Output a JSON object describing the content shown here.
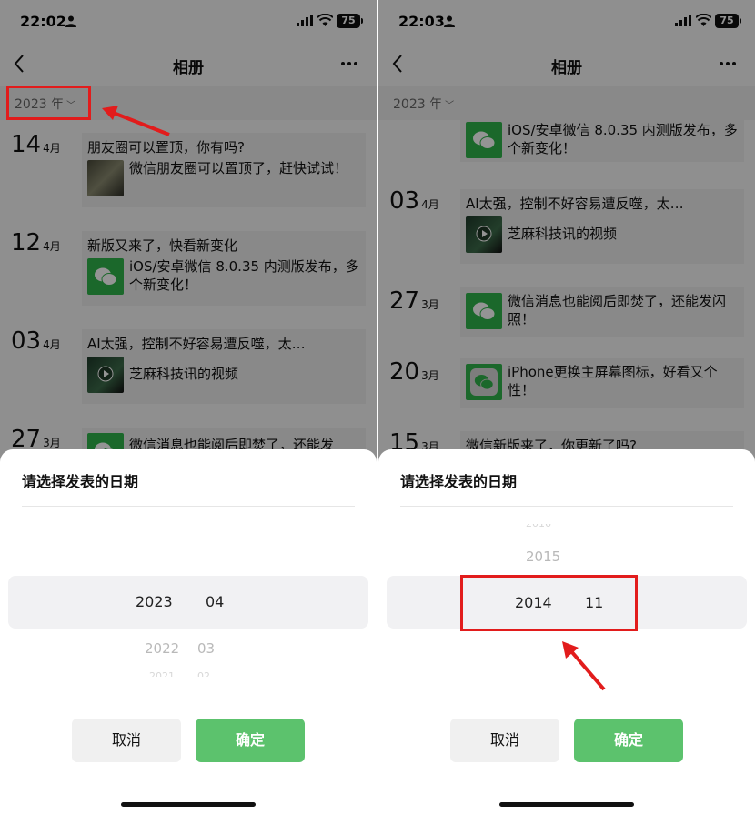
{
  "left": {
    "status": {
      "time": "22:02",
      "battery": "75"
    },
    "nav": {
      "title": "相册"
    },
    "year_selector": {
      "label": "2023 年"
    },
    "entries": [
      {
        "day": "14",
        "month": "4月",
        "title": "朋友圈可以置顶，你有吗?",
        "item_text": "微信朋友圈可以置顶了，赶快试试！",
        "thumb": "photo"
      },
      {
        "day": "12",
        "month": "4月",
        "title": "新版又来了，快看新变化",
        "item_text": "iOS/安卓微信 8.0.35 内测版发布，多个新变化！",
        "thumb": "wechat"
      },
      {
        "day": "03",
        "month": "4月",
        "title": "AI太强，控制不好容易遭反噬，太…",
        "item_text": "芝麻科技讯的视频",
        "thumb": "video"
      },
      {
        "day": "27",
        "month": "3月",
        "title": "",
        "item_text": "微信消息也能阅后即焚了，还能发",
        "thumb": "wechat"
      }
    ],
    "sheet": {
      "title": "请选择发表的日期",
      "selected_year": "2023",
      "selected_month": "04",
      "next_year": "2022",
      "next_month": "03",
      "faint_year": "2021",
      "faint_month": "02",
      "cancel": "取消",
      "confirm": "确定"
    }
  },
  "right": {
    "status": {
      "time": "22:03",
      "battery": "75"
    },
    "nav": {
      "title": "相册"
    },
    "year_selector": {
      "label": "2023 年"
    },
    "entries": [
      {
        "day": "",
        "month": "",
        "title": "",
        "item_text": "iOS/安卓微信 8.0.35 内测版发布，多个新变化！",
        "thumb": "wechat"
      },
      {
        "day": "03",
        "month": "4月",
        "title": "AI太强，控制不好容易遭反噬，太…",
        "item_text": "芝麻科技讯的视频",
        "thumb": "video"
      },
      {
        "day": "27",
        "month": "3月",
        "title": "",
        "item_text": "微信消息也能阅后即焚了，还能发闪照！",
        "thumb": "wechat"
      },
      {
        "day": "20",
        "month": "3月",
        "title": "",
        "item_text": "iPhone更换主屏幕图标，好看又个性！",
        "thumb": "wechat-gray"
      },
      {
        "day": "15",
        "month": "3月",
        "title": "微信新版来了，你更新了吗?",
        "item_text": "",
        "thumb": ""
      }
    ],
    "sheet": {
      "title": "请选择发表的日期",
      "faint_year": "2016",
      "prev_year": "2015",
      "selected_year": "2014",
      "selected_month": "11",
      "cancel": "取消",
      "confirm": "确定"
    }
  },
  "colors": {
    "accent_green": "#5cc26d",
    "wechat_green": "#2fb34a",
    "highlight_red": "#e21c1c"
  }
}
